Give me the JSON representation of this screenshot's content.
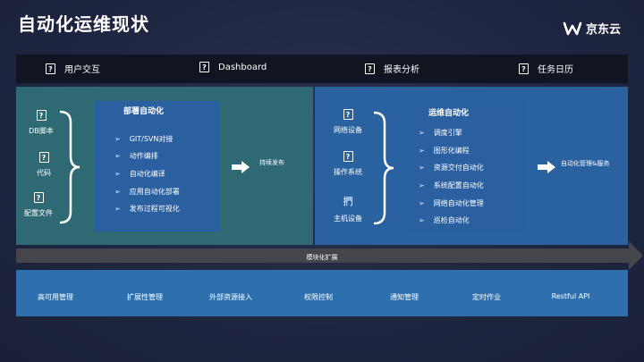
{
  "title": "自动化运维现状",
  "brand": {
    "name": "京东云"
  },
  "top_bar": [
    {
      "label": "用户交互",
      "icon": "?"
    },
    {
      "label": "Dashboard",
      "icon": "?"
    },
    {
      "label": "报表分析",
      "icon": "?"
    },
    {
      "label": "任务日历",
      "icon": "?"
    }
  ],
  "left_panel": {
    "sources": [
      {
        "icon": "?",
        "label": "DB脚本"
      },
      {
        "icon": "?",
        "label": "代码"
      },
      {
        "icon": "?",
        "label": "配置文件"
      }
    ],
    "box_title": "部署自动化",
    "items": [
      "GIT/SVN对接",
      "动作编排",
      "自动化编译",
      "应用自动化部署",
      "发布过程可视化"
    ],
    "output": "持续发布"
  },
  "right_panel": {
    "sources": [
      {
        "icon": "?",
        "label": "网络设备"
      },
      {
        "icon": "?",
        "label": "操作系统"
      },
      {
        "icon": "捫",
        "label": "主机设备"
      }
    ],
    "box_title": "运维自动化",
    "items": [
      "调度引擎",
      "图形化编程",
      "资源交付自动化",
      "系统配置自动化",
      "网络自动化管理",
      "巡检自动化"
    ],
    "output": "自动化管理&服务"
  },
  "band_label": "模块化扩展",
  "bottom_items": [
    "高可用管理",
    "扩展性管理",
    "外部资源接入",
    "权限控制",
    "通知管理",
    "定时作业",
    "Restful API"
  ],
  "list_bullet": "➢",
  "colors": {
    "background": "#1e2540",
    "top_bar": "#111522",
    "left_panel": "#2f6a74",
    "right_panel": "#2a62a0",
    "inner_box": "#2a5fa0",
    "band": "#44464c",
    "bottom_bar": "#2d70ad"
  }
}
